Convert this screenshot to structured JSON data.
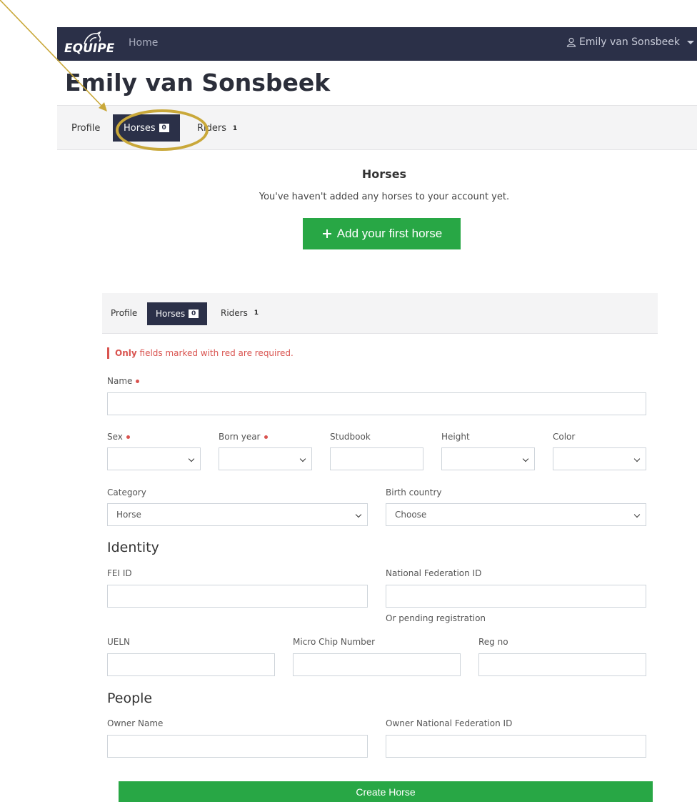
{
  "nav": {
    "brand": "EQUIPE",
    "home": "Home",
    "user": "Emily van Sonsbeek"
  },
  "page": {
    "title": "Emily van Sonsbeek"
  },
  "tabs": [
    {
      "label": "Profile",
      "badge": ""
    },
    {
      "label": "Horses",
      "badge": "0"
    },
    {
      "label": "Riders",
      "badge": "1"
    }
  ],
  "horses_section": {
    "heading": "Horses",
    "empty_message": "You've haven't added any horses to your account yet.",
    "add_button": "Add your first horse"
  },
  "form": {
    "tabs": [
      {
        "label": "Profile",
        "badge": ""
      },
      {
        "label": "Horses",
        "badge": "0"
      },
      {
        "label": "Riders",
        "badge": "1"
      }
    ],
    "required_note_bold": "Only",
    "required_note": "fields marked with red are required.",
    "name_label": "Name",
    "sex_label": "Sex",
    "born_year_label": "Born year",
    "studbook_label": "Studbook",
    "height_label": "Height",
    "color_label": "Color",
    "category_label": "Category",
    "category_value": "Horse",
    "birth_country_label": "Birth country",
    "birth_country_value": "Choose",
    "identity_title": "Identity",
    "fei_id_label": "FEI ID",
    "nf_id_label": "National Federation ID",
    "pending_text": "Or pending registration",
    "ueln_label": "UELN",
    "chip_label": "Micro Chip Number",
    "regno_label": "Reg no",
    "people_title": "People",
    "owner_name_label": "Owner Name",
    "owner_nf_label": "Owner National Federation ID",
    "submit": "Create Horse"
  },
  "colors": {
    "navbar": "#2b3048",
    "primary_green": "#28a745",
    "required_red": "#d9534f",
    "annotation_gold": "#c9a83a"
  }
}
